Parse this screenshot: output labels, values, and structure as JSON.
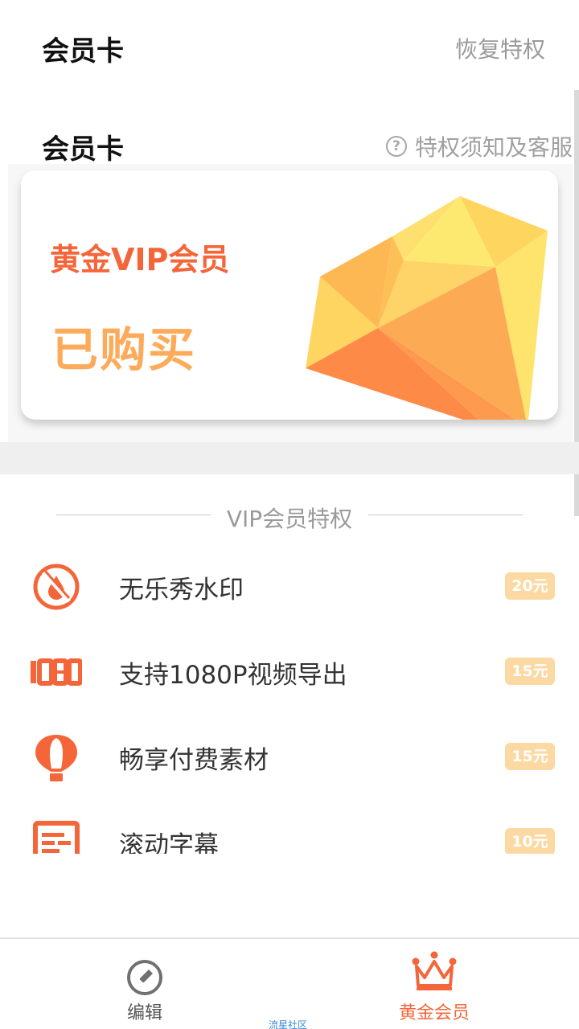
{
  "header": {
    "title": "会员卡",
    "restore_label": "恢复特权"
  },
  "card_section": {
    "title": "会员卡",
    "help_label": "特权须知及客服",
    "help_icon": "question-circle-icon",
    "card": {
      "tier": "黄金VIP会员",
      "status": "已购买",
      "art": "diamond-gem-icon"
    }
  },
  "privileges": {
    "heading": "VIP会员特权",
    "items": [
      {
        "icon": "no-watermark-icon",
        "name": "无乐秀水印",
        "price": "20元"
      },
      {
        "icon": "1080-icon",
        "name": "支持1080P视频导出",
        "price": "15元"
      },
      {
        "icon": "hot-air-balloon-icon",
        "name": "畅享付费素材",
        "price": "15元"
      },
      {
        "icon": "subtitle-icon",
        "name": "滚动字幕",
        "price": "10元"
      }
    ]
  },
  "tabbar": {
    "tabs": [
      {
        "label": "编辑",
        "icon": "edit-pencil-icon",
        "active": false
      },
      {
        "label": "黄金会员",
        "icon": "crown-icon",
        "active": true
      }
    ]
  },
  "watermark": "流星社区",
  "colors": {
    "accent": "#f4663a",
    "gold": "#fdab5a",
    "price_badge": "#fcd9a2",
    "muted": "#9a9a9a"
  }
}
